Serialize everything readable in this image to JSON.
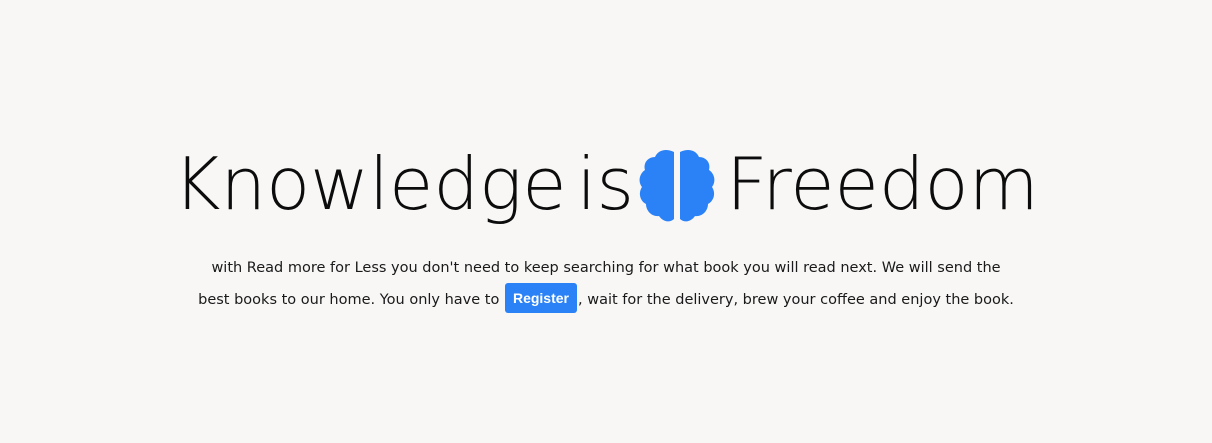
{
  "hero": {
    "headline_part1": "Knowledge",
    "headline_part2": "is",
    "headline_part3": "Freedom",
    "icon": "brain-icon",
    "accent_color": "#2b82f6",
    "tagline_line1": "with Read more for Less you don't need to keep searching for what book you will read next. We will send the",
    "tagline_line2_before": "best books to our home. You only have to ",
    "register_label": "Register",
    "tagline_line2_after": ", wait for the delivery, brew your coffee and enjoy the book."
  }
}
